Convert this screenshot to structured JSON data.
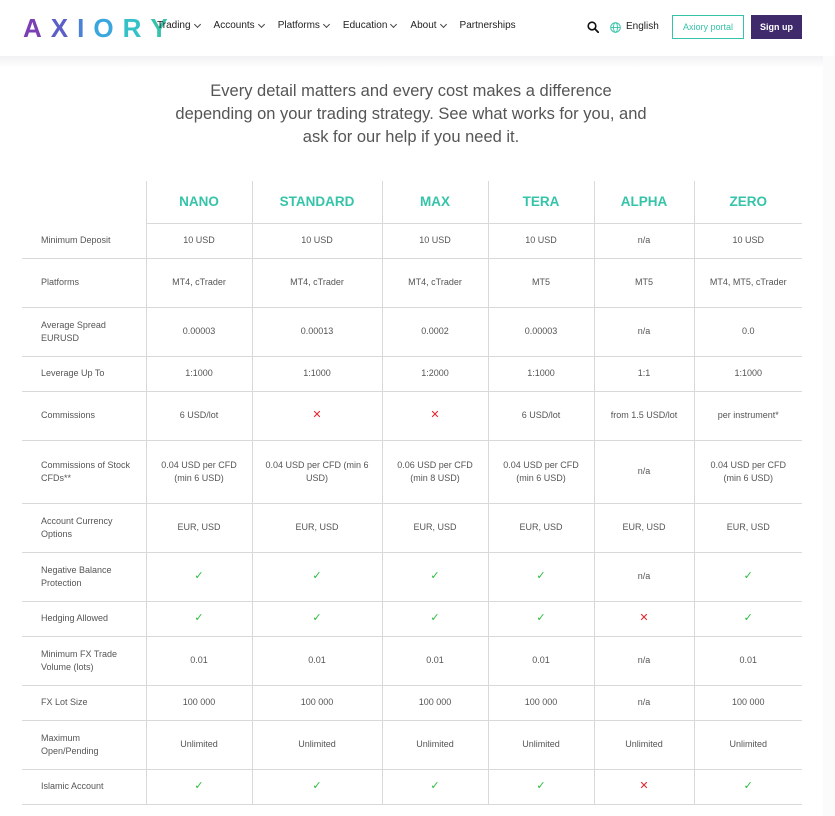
{
  "header": {
    "logo_letters": [
      "A",
      "X",
      "I",
      "O",
      "R",
      "Y"
    ],
    "logo_colors": [
      "#7b3fb5",
      "#5c5fc7",
      "#4b82d6",
      "#3aa6de",
      "#36c1c9",
      "#35c4a9"
    ],
    "nav": [
      "Trading",
      "Accounts",
      "Platforms",
      "Education",
      "About",
      "Partnerships"
    ],
    "language": "English",
    "portal_label": "Axiory portal",
    "signup_label": "Sign up"
  },
  "intro_text": "Every detail matters and every cost makes a difference depending on your trading strategy. See what works for you, and ask for our help if you need it.",
  "colors": {
    "accent": "#35c4a9",
    "brand_dark": "#3f2a6b",
    "check": "#2bbd3b",
    "cross": "#e2262d"
  },
  "table": {
    "columns": [
      "NANO",
      "STANDARD",
      "MAX",
      "TERA",
      "ALPHA",
      "ZERO"
    ],
    "rows": [
      {
        "label": "Minimum Deposit",
        "cells": [
          "10 USD",
          "10 USD",
          "10 USD",
          "10 USD",
          "n/a",
          "10 USD"
        ]
      },
      {
        "label": "Platforms",
        "cells": [
          "MT4, cTrader",
          "MT4, cTrader",
          "MT4, cTrader",
          "MT5",
          "MT5",
          "MT4, MT5, cTrader"
        ]
      },
      {
        "label": "Average Spread EURUSD",
        "cells": [
          "0.00003",
          "0.00013",
          "0.0002",
          "0.00003",
          "n/a",
          "0.0"
        ]
      },
      {
        "label": "Leverage Up To",
        "cells": [
          "1:1000",
          "1:1000",
          "1:2000",
          "1:1000",
          "1:1",
          "1:1000"
        ]
      },
      {
        "label": "Commissions",
        "cells": [
          "6 USD/lot",
          "✕",
          "✕",
          "6 USD/lot",
          "from 1.5 USD/lot",
          "per instrument*"
        ]
      },
      {
        "label": "Commissions of Stock CFDs**",
        "cells": [
          "0.04 USD per CFD (min 6 USD)",
          "0.04 USD per CFD (min 6 USD)",
          "0.06 USD per CFD (min 8 USD)",
          "0.04 USD per CFD (min 6 USD)",
          "n/a",
          "0.04 USD per CFD (min 6 USD)"
        ]
      },
      {
        "label": "Account Currency Options",
        "cells": [
          "EUR, USD",
          "EUR, USD",
          "EUR, USD",
          "EUR, USD",
          "EUR, USD",
          "EUR, USD"
        ]
      },
      {
        "label": "Negative Balance Protection",
        "cells": [
          "✓",
          "✓",
          "✓",
          "✓",
          "n/a",
          "✓"
        ]
      },
      {
        "label": "Hedging Allowed",
        "cells": [
          "✓",
          "✓",
          "✓",
          "✓",
          "✕",
          "✓"
        ]
      },
      {
        "label": "Minimum FX Trade Volume (lots)",
        "cells": [
          "0.01",
          "0.01",
          "0.01",
          "0.01",
          "n/a",
          "0.01"
        ]
      },
      {
        "label": "FX Lot Size",
        "cells": [
          "100 000",
          "100 000",
          "100 000",
          "100 000",
          "n/a",
          "100 000"
        ]
      },
      {
        "label": "Maximum Open/Pending",
        "cells": [
          "Unlimited",
          "Unlimited",
          "Unlimited",
          "Unlimited",
          "Unlimited",
          "Unlimited"
        ]
      },
      {
        "label": "Islamic Account",
        "cells": [
          "✓",
          "✓",
          "✓",
          "✓",
          "✕",
          "✓"
        ]
      }
    ]
  }
}
